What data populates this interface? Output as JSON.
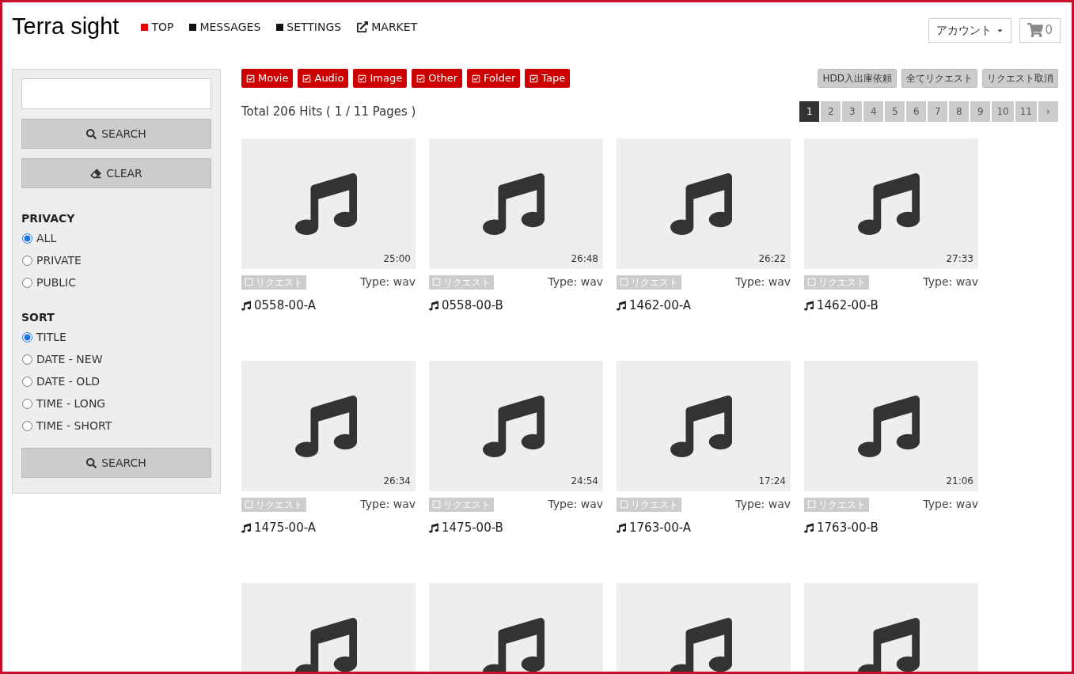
{
  "header": {
    "title": "Terra sight",
    "nav": [
      {
        "label": "TOP",
        "kind": "square",
        "selected": true
      },
      {
        "label": "MESSAGES",
        "kind": "square",
        "selected": false
      },
      {
        "label": "SETTINGS",
        "kind": "square",
        "selected": false
      },
      {
        "label": "MARKET",
        "kind": "external",
        "selected": false
      }
    ],
    "account": "アカウント",
    "cart_count": "0"
  },
  "sidebar": {
    "search_button": "SEARCH",
    "clear_button": "CLEAR",
    "groups": [
      {
        "title": "PRIVACY",
        "options": [
          {
            "label": "ALL",
            "selected": true
          },
          {
            "label": "PRIVATE",
            "selected": false
          },
          {
            "label": "PUBLIC",
            "selected": false
          }
        ]
      },
      {
        "title": "SORT",
        "options": [
          {
            "label": "TITLE",
            "selected": true
          },
          {
            "label": "DATE - NEW",
            "selected": false
          },
          {
            "label": "DATE - OLD",
            "selected": false
          },
          {
            "label": "TIME - LONG",
            "selected": false
          },
          {
            "label": "TIME - SHORT",
            "selected": false
          }
        ]
      }
    ],
    "bottom_search_button": "SEARCH"
  },
  "filters": [
    {
      "label": "Movie",
      "checked": true
    },
    {
      "label": "Audio",
      "checked": true
    },
    {
      "label": "Image",
      "checked": true
    },
    {
      "label": "Other",
      "checked": true
    },
    {
      "label": "Folder",
      "checked": true
    },
    {
      "label": "Tape",
      "checked": true
    }
  ],
  "actions": [
    "HDD入出庫依頼",
    "全てリクエスト",
    "リクエスト取消"
  ],
  "hits": "Total 206 Hits ( 1 / 11 Pages )",
  "pages": [
    {
      "label": "1",
      "selected": true
    },
    {
      "label": "2",
      "selected": false
    },
    {
      "label": "3",
      "selected": false
    },
    {
      "label": "4",
      "selected": false
    },
    {
      "label": "5",
      "selected": false
    },
    {
      "label": "6",
      "selected": false
    },
    {
      "label": "7",
      "selected": false
    },
    {
      "label": "8",
      "selected": false
    },
    {
      "label": "9",
      "selected": false
    },
    {
      "label": "10",
      "selected": false
    },
    {
      "label": "11",
      "selected": false
    },
    {
      "label": "›",
      "selected": false
    }
  ],
  "items": [
    {
      "kind": "full",
      "duration": "25:00",
      "request": "リクエスト",
      "checked": false,
      "type": "Type: wav",
      "title": "0558-00-A"
    },
    {
      "kind": "full",
      "duration": "26:48",
      "request": "リクエスト",
      "checked": false,
      "type": "Type: wav",
      "title": "0558-00-B"
    },
    {
      "kind": "full",
      "duration": "26:22",
      "request": "リクエスト",
      "checked": false,
      "type": "Type: wav",
      "title": "1462-00-A"
    },
    {
      "kind": "full",
      "duration": "27:33",
      "request": "リクエスト",
      "checked": false,
      "type": "Type: wav",
      "title": "1462-00-B"
    },
    {
      "kind": "full",
      "duration": "26:34",
      "request": "リクエスト",
      "checked": false,
      "type": "Type: wav",
      "title": "1475-00-A"
    },
    {
      "kind": "full",
      "duration": "24:54",
      "request": "リクエスト",
      "checked": false,
      "type": "Type: wav",
      "title": "1475-00-B"
    },
    {
      "kind": "full",
      "duration": "17:24",
      "request": "リクエスト",
      "checked": false,
      "type": "Type: wav",
      "title": "1763-00-A"
    },
    {
      "kind": "full",
      "duration": "21:06",
      "request": "リクエスト",
      "checked": false,
      "type": "Type: wav",
      "title": "1763-00-B"
    },
    {
      "kind": "thumbnail_only"
    },
    {
      "kind": "thumbnail_only"
    },
    {
      "kind": "thumbnail_only"
    },
    {
      "kind": "thumbnail_only"
    }
  ]
}
